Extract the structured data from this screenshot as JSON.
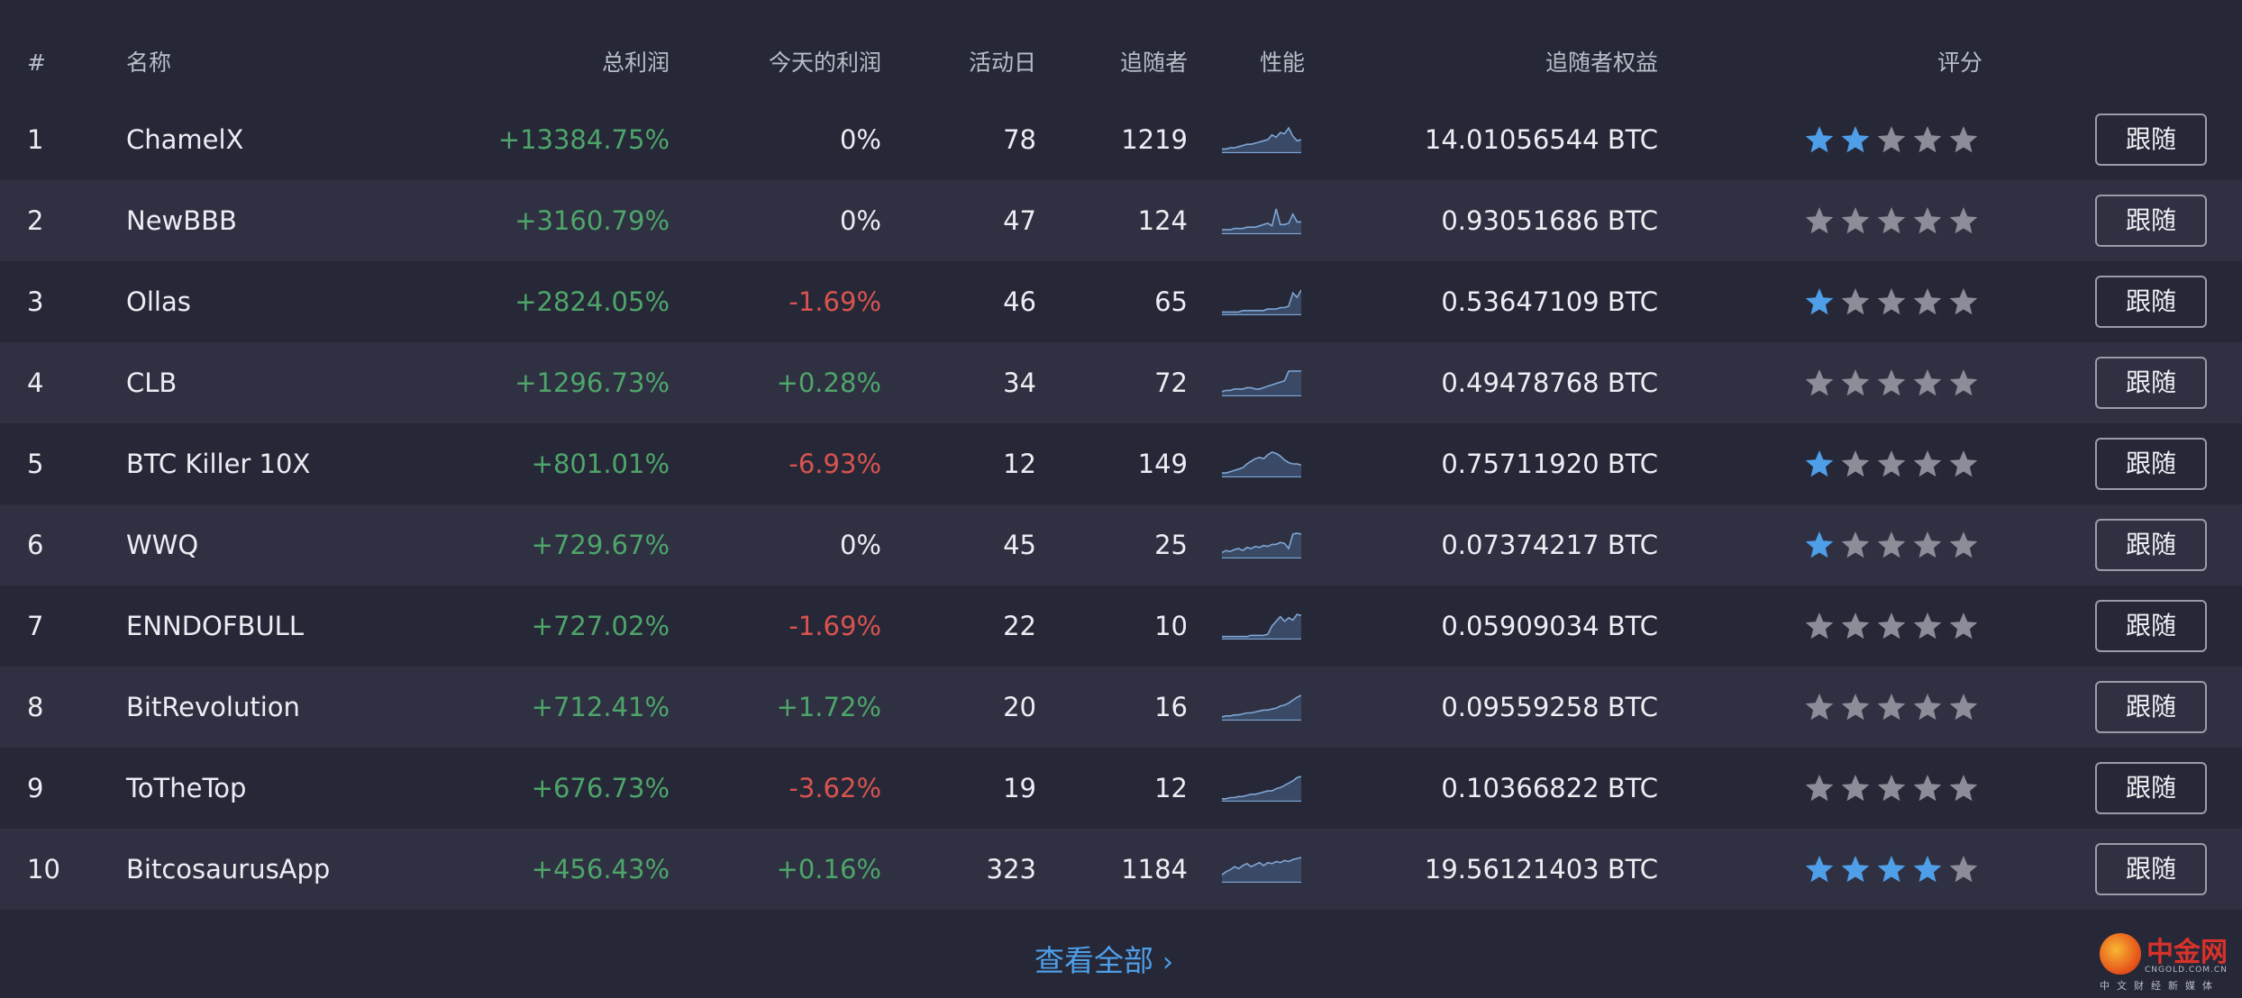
{
  "headers": {
    "rank": "#",
    "name": "名称",
    "total_profit": "总利润",
    "today_profit": "今天的利润",
    "active_days": "活动日",
    "followers": "追随者",
    "performance": "性能",
    "follower_equity": "追随者权益",
    "rating": "评分"
  },
  "follow_label": "跟随",
  "view_all": "查看全部",
  "view_all_chevron": "›",
  "watermark": {
    "name": "中金网",
    "domain": "CNGOLD.COM.CN",
    "tagline": "中文财经新媒体"
  },
  "colors": {
    "positive": "#4ea56a",
    "negative": "#d9534f",
    "star_active": "#4f9ee8",
    "star_inactive": "#8b8d98",
    "link": "#4f9ee8"
  },
  "rows": [
    {
      "rank": "1",
      "name": "ChamelX",
      "total": "+13384.75%",
      "today": "0%",
      "today_sign": "neu",
      "days": "78",
      "followers": "1219",
      "equity": "14.01056544 BTC",
      "rating": 2,
      "spark": [
        2,
        2,
        3,
        3,
        4,
        5,
        6,
        6,
        7,
        8,
        9,
        10,
        14,
        12,
        16,
        15,
        20,
        13,
        9,
        10
      ]
    },
    {
      "rank": "2",
      "name": "NewBBB",
      "total": "+3160.79%",
      "today": "0%",
      "today_sign": "neu",
      "days": "47",
      "followers": "124",
      "equity": "0.93051686 BTC",
      "rating": 0,
      "spark": [
        2,
        2,
        2,
        3,
        3,
        3,
        4,
        4,
        4,
        5,
        6,
        7,
        5,
        18,
        6,
        6,
        7,
        14,
        8,
        8
      ]
    },
    {
      "rank": "3",
      "name": "Ollas",
      "total": "+2824.05%",
      "today": "-1.69%",
      "today_sign": "neg",
      "days": "46",
      "followers": "65",
      "equity": "0.53647109 BTC",
      "rating": 1,
      "spark": [
        1,
        1,
        1,
        1,
        1,
        2,
        2,
        2,
        2,
        2,
        2,
        3,
        3,
        3,
        4,
        4,
        5,
        14,
        11,
        16
      ]
    },
    {
      "rank": "4",
      "name": "CLB",
      "total": "+1296.73%",
      "today": "+0.28%",
      "today_sign": "pos",
      "days": "34",
      "followers": "72",
      "equity": "0.49478768 BTC",
      "rating": 0,
      "spark": [
        2,
        3,
        3,
        4,
        4,
        4,
        5,
        5,
        4,
        4,
        5,
        6,
        7,
        8,
        9,
        10,
        17,
        17,
        17,
        17
      ]
    },
    {
      "rank": "5",
      "name": "BTC Killer 10X",
      "total": "+801.01%",
      "today": "-6.93%",
      "today_sign": "neg",
      "days": "12",
      "followers": "149",
      "equity": "0.75711920 BTC",
      "rating": 1,
      "spark": [
        2,
        2,
        3,
        4,
        5,
        6,
        9,
        11,
        13,
        14,
        13,
        16,
        18,
        17,
        15,
        12,
        10,
        9,
        9,
        8
      ]
    },
    {
      "rank": "6",
      "name": "WWQ",
      "total": "+729.67%",
      "today": "0%",
      "today_sign": "neu",
      "days": "45",
      "followers": "25",
      "equity": "0.07374217 BTC",
      "rating": 1,
      "spark": [
        4,
        6,
        5,
        7,
        8,
        6,
        9,
        8,
        10,
        9,
        11,
        10,
        12,
        12,
        14,
        13,
        8,
        22,
        23,
        22
      ]
    },
    {
      "rank": "7",
      "name": "ENNDOFBULL",
      "total": "+727.02%",
      "today": "-1.69%",
      "today_sign": "neg",
      "days": "22",
      "followers": "10",
      "equity": "0.05909034 BTC",
      "rating": 0,
      "spark": [
        1,
        1,
        1,
        1,
        1,
        1,
        1,
        2,
        2,
        2,
        2,
        3,
        10,
        14,
        18,
        14,
        17,
        15,
        20,
        19
      ]
    },
    {
      "rank": "8",
      "name": "BitRevolution",
      "total": "+712.41%",
      "today": "+1.72%",
      "today_sign": "pos",
      "days": "20",
      "followers": "16",
      "equity": "0.09559258 BTC",
      "rating": 0,
      "spark": [
        2,
        3,
        3,
        4,
        4,
        5,
        6,
        6,
        7,
        8,
        9,
        9,
        10,
        11,
        13,
        14,
        16,
        19,
        22,
        24
      ]
    },
    {
      "rank": "9",
      "name": "ToTheTop",
      "total": "+676.73%",
      "today": "-3.62%",
      "today_sign": "neg",
      "days": "19",
      "followers": "12",
      "equity": "0.10366822 BTC",
      "rating": 0,
      "spark": [
        1,
        1,
        2,
        2,
        3,
        3,
        4,
        5,
        5,
        6,
        7,
        8,
        8,
        10,
        11,
        13,
        15,
        17,
        20,
        21
      ]
    },
    {
      "rank": "10",
      "name": "BitcosaurusApp",
      "total": "+456.43%",
      "today": "+0.16%",
      "today_sign": "pos",
      "days": "323",
      "followers": "1184",
      "equity": "19.56121403 BTC",
      "rating": 4,
      "spark": [
        6,
        9,
        11,
        14,
        12,
        15,
        17,
        14,
        16,
        18,
        15,
        18,
        17,
        19,
        18,
        20,
        19,
        21,
        22,
        23
      ]
    }
  ]
}
